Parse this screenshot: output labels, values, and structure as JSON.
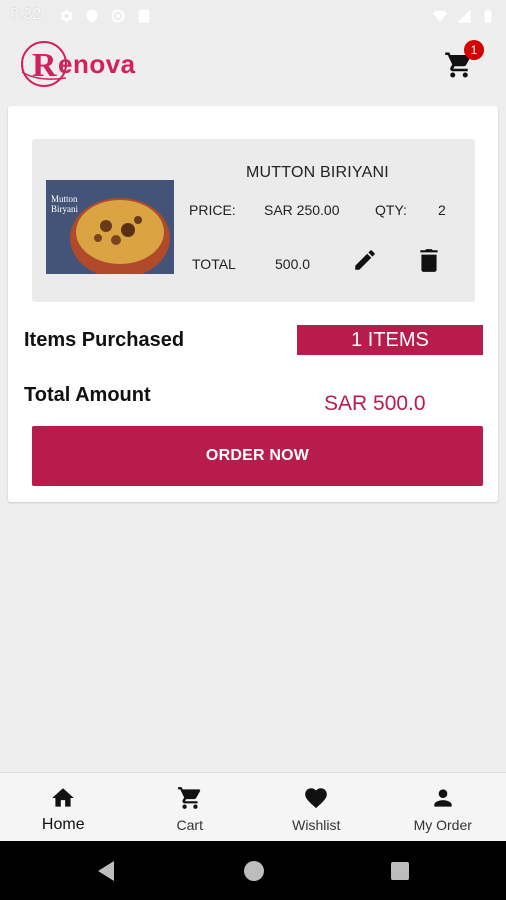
{
  "status_bar": {
    "time": "8:32"
  },
  "header": {
    "logo_text": "Renova",
    "cart_badge_count": "1",
    "brand_color": "#b71c4d"
  },
  "cart_item": {
    "name": "MUTTON BIRIYANI",
    "price_label": "PRICE:",
    "price_value": "SAR 250.00",
    "qty_label": "QTY:",
    "qty_value": "2",
    "total_label": "TOTAL",
    "total_value": "500.0",
    "image_caption": "Mutton Biryani"
  },
  "summary": {
    "items_purchased_label": "Items Purchased",
    "items_count": "1 ITEMS",
    "total_amount_label": "Total Amount",
    "total_amount_value": "SAR 500.0",
    "order_button": "ORDER NOW"
  },
  "bottom_nav": {
    "items": [
      {
        "label": "Home",
        "icon": "home-icon"
      },
      {
        "label": "Cart",
        "icon": "cart-icon"
      },
      {
        "label": "Wishlist",
        "icon": "heart-icon"
      },
      {
        "label": "My Order",
        "icon": "person-icon"
      }
    ]
  }
}
